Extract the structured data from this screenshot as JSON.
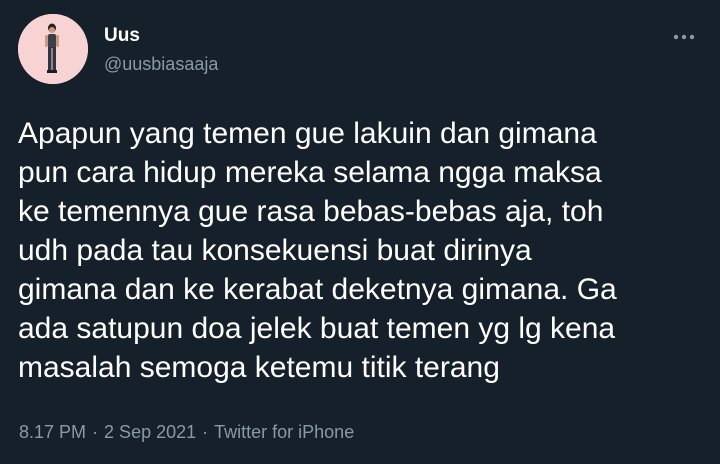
{
  "author": {
    "display_name": "Uus",
    "handle": "@uusbiasaaja",
    "avatar_icon": "person-avatar-icon",
    "avatar_bg": "#f7d3d4"
  },
  "menu_icon": "more-horizontal-icon",
  "tweet": {
    "lines": [
      "Apapun yang temen gue lakuin dan gimana",
      "pun cara hidup mereka selama ngga maksa",
      "ke temennya gue rasa bebas-bebas aja, toh",
      "udh pada tau konsekuensi buat dirinya",
      "gimana dan ke kerabat deketnya gimana. Ga",
      "ada satupun doa jelek buat temen yg lg kena",
      "masalah semoga ketemu titik terang"
    ]
  },
  "meta": {
    "time": "8.17 PM",
    "separator": "·",
    "date": "2 Sep 2021",
    "source": "Twitter for iPhone"
  },
  "colors": {
    "background": "#15202b",
    "text": "#ffffff",
    "secondary": "#8b98a5"
  }
}
